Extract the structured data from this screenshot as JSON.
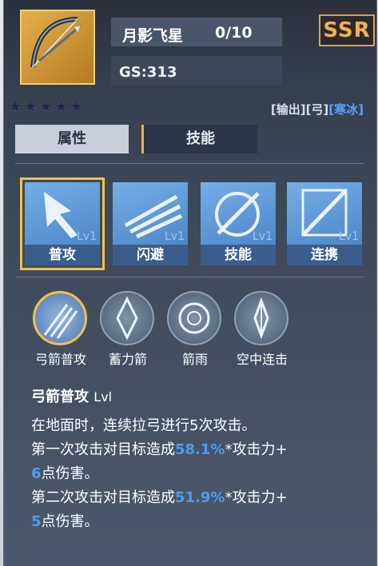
{
  "item": {
    "name": "月影飞星",
    "count": "0/10",
    "gs": "GS:313",
    "rarity": "SSR",
    "stars": 5,
    "tags": [
      "[输出]",
      "[弓]",
      "[寒冰]"
    ],
    "tag_colors": [
      "#d8dde6",
      "#d8dde6",
      "#5ba0ff"
    ]
  },
  "tabs": [
    "属性",
    "技能"
  ],
  "skills": [
    {
      "label": "普攻",
      "level": "Lv1",
      "icon": "arrow-icon"
    },
    {
      "label": "闪避",
      "level": "Lv1",
      "icon": "dash-icon"
    },
    {
      "label": "技能",
      "level": "Lv1",
      "icon": "target-icon"
    },
    {
      "label": "连携",
      "level": "Lv1",
      "icon": "crossbow-icon"
    }
  ],
  "sub_skills": [
    {
      "label": "弓箭普攻",
      "icon": "arrows-icon"
    },
    {
      "label": "蓄力箭",
      "icon": "charged-arrow-icon"
    },
    {
      "label": "箭雨",
      "icon": "arrow-rain-icon"
    },
    {
      "label": "空中连击",
      "icon": "air-combo-icon"
    }
  ],
  "description": {
    "title": "弓箭普攻",
    "level": "Lvl",
    "line1": "在地面时，连续拉弓进行5次攻击。",
    "line2_pre": "第一次攻击对目标造成",
    "line2_val": "58.1%",
    "line2_post": "*攻击力+",
    "line3_val": "6",
    "line3_post": "点伤害。",
    "line4_pre": "第二次攻击对目标造成",
    "line4_val": "51.9%",
    "line4_post": "*攻击力+",
    "line5_val": "5",
    "line5_post": "点伤害。"
  }
}
